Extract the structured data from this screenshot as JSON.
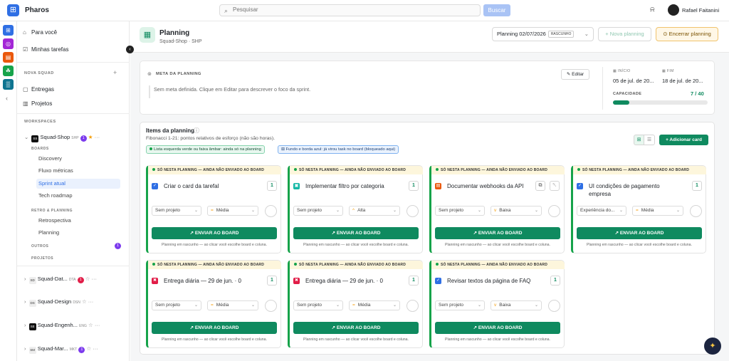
{
  "app": {
    "logo_glyph": "⊞",
    "name": "Pharos"
  },
  "search": {
    "placeholder": "Pesquisar",
    "button": "Buscar"
  },
  "user": {
    "name": "Rafael Faitanini"
  },
  "rail": [
    {
      "glyph": "⊞",
      "color": "#2f6fe4"
    },
    {
      "glyph": "◎",
      "color": "#a326d6"
    },
    {
      "glyph": "▤",
      "color": "#ea580c"
    },
    {
      "glyph": "☘",
      "color": "#16a34a"
    },
    {
      "glyph": "▒",
      "color": "#0e7490"
    }
  ],
  "sidebar": {
    "para_voce": "Para você",
    "minhas_tarefas": "Minhas tarefas",
    "nova_squad": "NOVA SQUAD",
    "entregas": "Entregas",
    "projetos": "Projetos",
    "workspaces": "WORKSPACES",
    "squads": [
      {
        "name": "Squad-Shop",
        "code": "SHP",
        "count": "1"
      },
      {
        "name": "Squad-Dat...",
        "code": "DTA",
        "count": "1"
      },
      {
        "name": "Squad-Design",
        "code": "DSN",
        "count": ""
      },
      {
        "name": "Squad-Engenh...",
        "code": "ENG",
        "count": ""
      },
      {
        "name": "Squad-Mar...",
        "code": "MKT",
        "count": "1"
      }
    ],
    "boards_label": "BOARDS",
    "boards": [
      "Discovery",
      "Fluxo métricas",
      "Sprint atual",
      "Tech roadmap"
    ],
    "retro_label": "RETRO & PLANNING",
    "retro": [
      "Retrospectiva",
      "Planning"
    ],
    "outros_label": "OUTROS",
    "outros_count": "1",
    "projetos_label": "PROJETOS"
  },
  "page": {
    "title": "Planning",
    "subtitle": "Squad-Shop · SHP",
    "planning_select": "Planning 02/07/2026",
    "status": "RASCUNHO",
    "nova": "+ Nova planning",
    "encerrar": "Encerrar planning"
  },
  "meta": {
    "label": "META DA PLANNING",
    "edit": "Editar",
    "text": "Sem meta definida. Clique em Editar para descrever o foco da sprint.",
    "inicio_label": "INÍCIO",
    "inicio": "05 de jul. de 20...",
    "fim_label": "FIM",
    "fim": "18 de jul. de 20...",
    "capacidade_label": "CAPACIDADE",
    "capacidade": "7 / 40",
    "capacidade_used": 7,
    "capacidade_total": 40
  },
  "items": {
    "title": "Items da planning",
    "subtitle": "Fibonacci 1-21: pontos relativos de esforço (não são horas).",
    "legend_green": "Lista esquerda verde ou faixa âmbar: ainda só na planning",
    "legend_blue": "Fundo e borda azul: já virou task no board (bloqueado aqui)",
    "add": "+ Adicionar card"
  },
  "cards": [
    {
      "banner": "SÓ NESTA PLANNING — AINDA NÃO ENVIADO AO BOARD",
      "icon": "✓",
      "icon_color": "#2f6fe4",
      "title": "Criar o card da tarefal",
      "points": "1",
      "project": "Sem projeto",
      "priority": "Média",
      "priority_mark": "=",
      "send": "ENVIAR AO BOARD",
      "footer": "Planning em rascunho — ao clicar você escolhe board e coluna."
    },
    {
      "banner": "SÓ NESTA PLANNING — AINDA NÃO ENVIADO AO BOARD",
      "icon": "▣",
      "icon_color": "#14b8a6",
      "title": "Implementar filtro por categoria",
      "points": "1",
      "project": "Sem projeto",
      "priority": "Alta",
      "priority_mark": "^",
      "send": "ENVIAR AO BOARD",
      "footer": "Planning em rascunho — ao clicar você escolhe board e coluna."
    },
    {
      "banner": "SÓ NESTA PLANNING — AINDA NÃO ENVIADO AO BOARD",
      "icon": "▤",
      "icon_color": "#ea580c",
      "title": "Documentar webhooks da API",
      "points": "",
      "project": "Sem projeto",
      "priority": "Baixa",
      "priority_mark": "v",
      "send": "ENVIAR AO BOARD",
      "footer": "Planning em rascunho — ao clicar você escolhe board e coluna."
    },
    {
      "banner": "SÓ NESTA PLANNING — AINDA NÃO ENVIADO AO BOARD",
      "icon": "✓",
      "icon_color": "#2f6fe4",
      "title": "UI condições de pagamento empresa",
      "points": "1",
      "project": "Experiência do...",
      "priority": "Média",
      "priority_mark": "=",
      "send": "ENVIAR AO BOARD",
      "footer": "Planning em rascunho — ao clicar você escolhe board e coluna."
    },
    {
      "banner": "SÓ NESTA PLANNING — AINDA NÃO ENVIADO AO BOARD",
      "icon": "✖",
      "icon_color": "#e11d48",
      "title": "Entrega diária — 29 de jun. · 0",
      "points": "1",
      "project": "Sem projeto",
      "priority": "Média",
      "priority_mark": "=",
      "send": "ENVIAR AO BOARD",
      "footer": "Planning em rascunho — ao clicar você escolhe board e coluna."
    },
    {
      "banner": "SÓ NESTA PLANNING — AINDA NÃO ENVIADO AO BOARD",
      "icon": "✖",
      "icon_color": "#e11d48",
      "title": "Entrega diária — 29 de jun. · 0",
      "points": "1",
      "project": "Sem projeto",
      "priority": "Média",
      "priority_mark": "=",
      "send": "ENVIAR AO BOARD",
      "footer": "Planning em rascunho — ao clicar você escolhe board e coluna."
    },
    {
      "banner": "SÓ NESTA PLANNING — AINDA NÃO ENVIADO AO BOARD",
      "icon": "✓",
      "icon_color": "#2f6fe4",
      "title": "Revisar textos da página de FAQ",
      "points": "1",
      "project": "Sem projeto",
      "priority": "Baixa",
      "priority_mark": "v",
      "send": "ENVIAR AO BOARD",
      "footer": "Planning em rascunho — ao clicar você escolhe board e coluna."
    }
  ],
  "icons": {
    "search": "⌕",
    "bell": "⍾",
    "home": "⌂",
    "tasks": "☑",
    "truck": "▢",
    "folder": "▥",
    "chevron": "›",
    "star": "★",
    "more": "···",
    "plus": "+",
    "pencil": "✎",
    "rocket": "↗",
    "calendar": "▦",
    "copy": "⧉",
    "trash": "␡",
    "grid": "⊞",
    "list": "☰"
  }
}
